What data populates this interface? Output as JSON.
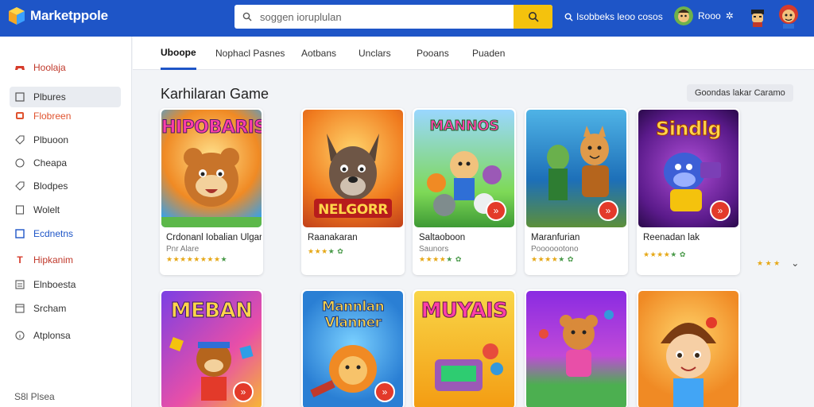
{
  "header": {
    "logo_text": "Marketppole",
    "search_placeholder": "soggen ioruplulan",
    "top_link": "Isobbeks leoo cosos",
    "user_name": "Rooo"
  },
  "sidebar": {
    "items": [
      {
        "label": "Hoolaja",
        "icon": "game-controller-icon"
      },
      {
        "label": "Plbures",
        "icon": "square-icon"
      },
      {
        "label": "Flobreen",
        "icon": "screen-icon"
      },
      {
        "label": "Plbuoon",
        "icon": "tag-icon"
      },
      {
        "label": "Cheapa",
        "icon": "circle-icon"
      },
      {
        "label": "Blodpes",
        "icon": "tag-icon"
      },
      {
        "label": "Wolelt",
        "icon": "wallet-icon"
      },
      {
        "label": "Ecdnetns",
        "icon": "square-icon"
      },
      {
        "label": "Hipkanim",
        "icon": "t-icon"
      },
      {
        "label": "Elnboesta",
        "icon": "list-icon"
      },
      {
        "label": "Srcham",
        "icon": "window-icon"
      },
      {
        "label": "Atplonsa",
        "icon": "info-icon"
      }
    ],
    "footer": "S8l Plsea"
  },
  "tabs": [
    "Uboope",
    "Nophacl Pasnes",
    "Aotbans",
    "Unclars",
    "Pooans",
    "Puaden"
  ],
  "section": {
    "title": "Karhilaran Game",
    "button": "Goondas lakar Caramo"
  },
  "cards_row1": [
    {
      "art_title": "HIPOBARIS",
      "title": "Crdonanl Iobalian Ulgar",
      "subtitle": "Pnr Alare",
      "stars": "★★★★★★★★",
      "rest": "★"
    },
    {
      "art_title": "NELGORR",
      "title": "Raanakaran",
      "subtitle": "",
      "stars": "★★★",
      "rest": "★ ✿"
    },
    {
      "art_title": "MANNOS",
      "title": "Saltaoboon",
      "subtitle": "Saunors",
      "stars": "★★★★",
      "rest": "★ ✿"
    },
    {
      "art_title": "",
      "title": "Maranfurian",
      "subtitle": "Pooooootono",
      "stars": "★★★★",
      "rest": "★ ✿"
    },
    {
      "art_title": "Sindlg",
      "title": "Reenadan lak",
      "subtitle": "",
      "stars": "★★★★",
      "rest": "★ ✿"
    }
  ],
  "cards_row2": [
    {
      "art_title": "MEBAN"
    },
    {
      "art_title": "Mannlan Vlanner"
    },
    {
      "art_title": "MUYAIS"
    },
    {
      "art_title": ""
    },
    {
      "art_title": ""
    }
  ],
  "more_stars": "★ ★ ★",
  "colors": {
    "brand": "#1e55c7",
    "search_button": "#f4c20d",
    "accent_red": "#e33a2a",
    "star": "#e6a817"
  }
}
